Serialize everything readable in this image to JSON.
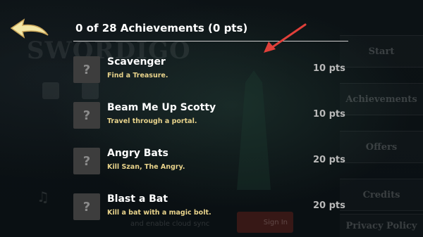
{
  "header": {
    "title": "0 of 28 Achievements (0 pts)"
  },
  "background": {
    "logo": "SWORDIGO",
    "menu": [
      "Start",
      "Achievements",
      "Offers",
      "Credits",
      "Privacy Policy"
    ],
    "sign_in": "Sign In",
    "cloud_sync": "and enable cloud sync"
  },
  "achievements": [
    {
      "badge": "?",
      "name": "Scavenger",
      "desc": "Find a Treasure.",
      "points": "10 pts"
    },
    {
      "badge": "?",
      "name": "Beam Me Up Scotty",
      "desc": "Travel through a portal.",
      "points": "10 pts"
    },
    {
      "badge": "?",
      "name": "Angry Bats",
      "desc": "Kill Szan, The Angry.",
      "points": "20 pts"
    },
    {
      "badge": "?",
      "name": "Blast a Bat",
      "desc": "Kill a bat with a magic bolt.",
      "points": "20 pts"
    }
  ],
  "colors": {
    "description": "#e8d38b",
    "points": "#b9b9b9",
    "badge": "#3d3d3d",
    "arrow": "#e0403a",
    "back_button": "#f3e7a6"
  },
  "icons": {
    "back": "back-arrow-icon",
    "pointer": "red-pointer-arrow-icon"
  }
}
